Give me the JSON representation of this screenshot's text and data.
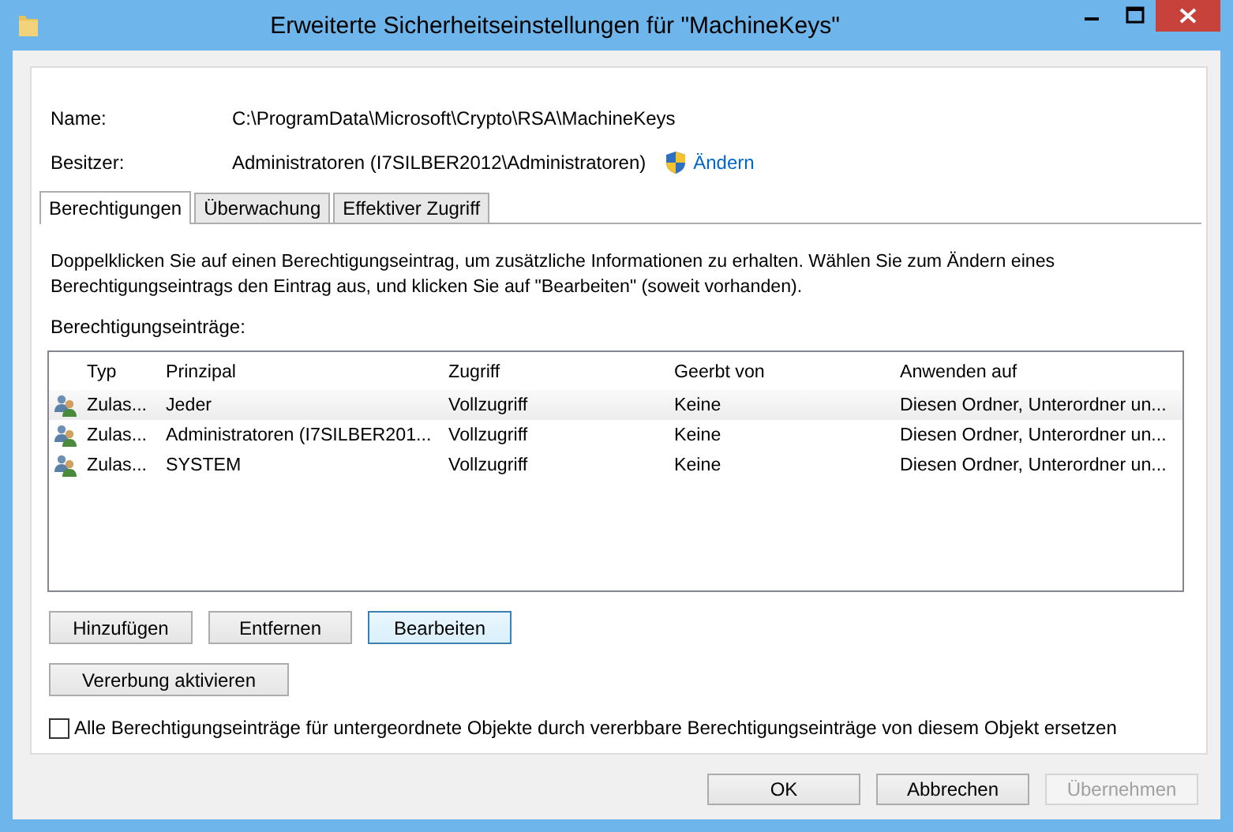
{
  "window": {
    "title": "Erweiterte Sicherheitseinstellungen für \"MachineKeys\""
  },
  "name": {
    "label": "Name:",
    "value": "C:\\ProgramData\\Microsoft\\Crypto\\RSA\\MachineKeys"
  },
  "owner": {
    "label": "Besitzer:",
    "value": "Administratoren (I7SILBER2012\\Administratoren)",
    "link": "Ändern"
  },
  "tabs": [
    {
      "label": "Berechtigungen",
      "selected": true
    },
    {
      "label": "Überwachung",
      "selected": false
    },
    {
      "label": "Effektiver Zugriff",
      "selected": false
    }
  ],
  "description": "Doppelklicken Sie auf einen Berechtigungseintrag, um zusätzliche Informationen zu erhalten. Wählen Sie zum Ändern eines Berechtigungseintrags den Eintrag aus, und klicken Sie auf \"Bearbeiten\" (soweit vorhanden).",
  "entries": {
    "label": "Berechtigungseinträge:",
    "columns": [
      "Typ",
      "Prinzipal",
      "Zugriff",
      "Geerbt von",
      "Anwenden auf"
    ],
    "rows": [
      {
        "cells": [
          "Zulas...",
          "Jeder",
          "Vollzugriff",
          "Keine",
          "Diesen Ordner, Unterordner un..."
        ],
        "selected": true
      },
      {
        "cells": [
          "Zulas...",
          "Administratoren (I7SILBER201...",
          "Vollzugriff",
          "Keine",
          "Diesen Ordner, Unterordner un..."
        ],
        "selected": false
      },
      {
        "cells": [
          "Zulas...",
          "SYSTEM",
          "Vollzugriff",
          "Keine",
          "Diesen Ordner, Unterordner un..."
        ],
        "selected": false
      }
    ]
  },
  "entry_buttons": [
    {
      "label": "Hinzufügen",
      "focused": false
    },
    {
      "label": "Entfernen",
      "focused": false
    },
    {
      "label": "Bearbeiten",
      "focused": true
    }
  ],
  "inheritance_button": "Vererbung aktivieren",
  "replace_checkbox": {
    "label": "Alle Berechtigungseinträge für untergeordnete Objekte durch vererbbare Berechtigungseinträge von diesem Objekt ersetzen",
    "checked": false
  },
  "dialog_buttons": [
    {
      "label": "OK",
      "disabled": false
    },
    {
      "label": "Abbrechen",
      "disabled": false
    },
    {
      "label": "Übernehmen",
      "disabled": true
    }
  ]
}
